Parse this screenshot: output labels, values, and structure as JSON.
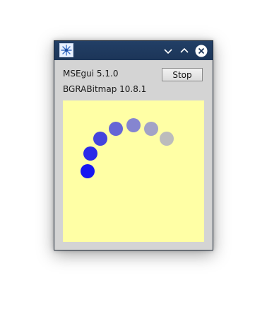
{
  "window": {
    "icon": "snowflake-app-icon",
    "title_buttons": {
      "minimize": "chevron-down-icon",
      "maximize": "chevron-up-icon",
      "close": "close-icon"
    }
  },
  "labels": {
    "version_gui": "MSEgui 5.1.0",
    "version_bitmap": "BGRABitmap 10.8.1"
  },
  "stop_button": {
    "label": "Stop"
  },
  "animation": {
    "background": "#ffffa5",
    "dot_colors": [
      "#1717f2",
      "#2a2ae8",
      "#4444dd",
      "#6666d6",
      "#8585d0",
      "#a3a3c6",
      "#bcbcbc"
    ]
  }
}
